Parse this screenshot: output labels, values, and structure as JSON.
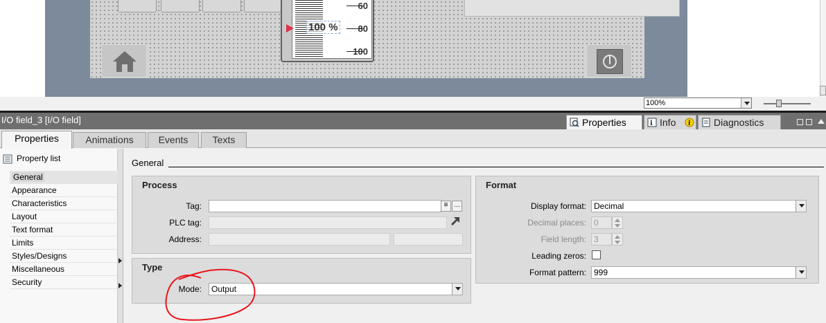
{
  "canvas": {
    "gauge": {
      "value_text": "100 %",
      "ticks": [
        "60",
        "80",
        "100"
      ]
    },
    "zoom": {
      "value": "100%"
    }
  },
  "inspector": {
    "title": "I/O field_3 [I/O field]",
    "tabs": [
      {
        "label": "Properties",
        "icon": "properties-icon",
        "active": true
      },
      {
        "label": "Info",
        "icon": "info-icon",
        "active": false
      },
      {
        "label": "Diagnostics",
        "icon": "diagnostics-icon",
        "active": false
      }
    ]
  },
  "subtabs": [
    "Properties",
    "Animations",
    "Events",
    "Texts"
  ],
  "nav": {
    "header": "Property list",
    "items": [
      "General",
      "Appearance",
      "Characteristics",
      "Layout",
      "Text format",
      "Limits",
      "Styles/Designs",
      "Miscellaneous",
      "Security"
    ],
    "selected": "General"
  },
  "main": {
    "section_title": "General",
    "process": {
      "title": "Process",
      "tag_label": "Tag:",
      "tag_value": "",
      "plc_tag_label": "PLC tag:",
      "plc_tag_value": "",
      "address_label": "Address:",
      "address_value": ""
    },
    "type": {
      "title": "Type",
      "mode_label": "Mode:",
      "mode_value": "Output"
    },
    "format": {
      "title": "Format",
      "display_format_label": "Display format:",
      "display_format_value": "Decimal",
      "decimal_places_label": "Decimal places:",
      "decimal_places_value": "0",
      "field_length_label": "Field length:",
      "field_length_value": "3",
      "leading_zeros_label": "Leading zeros:",
      "leading_zeros_checked": false,
      "format_pattern_label": "Format pattern:",
      "format_pattern_value": "999"
    }
  },
  "colors": {
    "bezel": "#7c8a9c",
    "header_bar": "#6f6f6f",
    "annotation": "#e8141b",
    "gauge_pointer": "#e0304a"
  }
}
